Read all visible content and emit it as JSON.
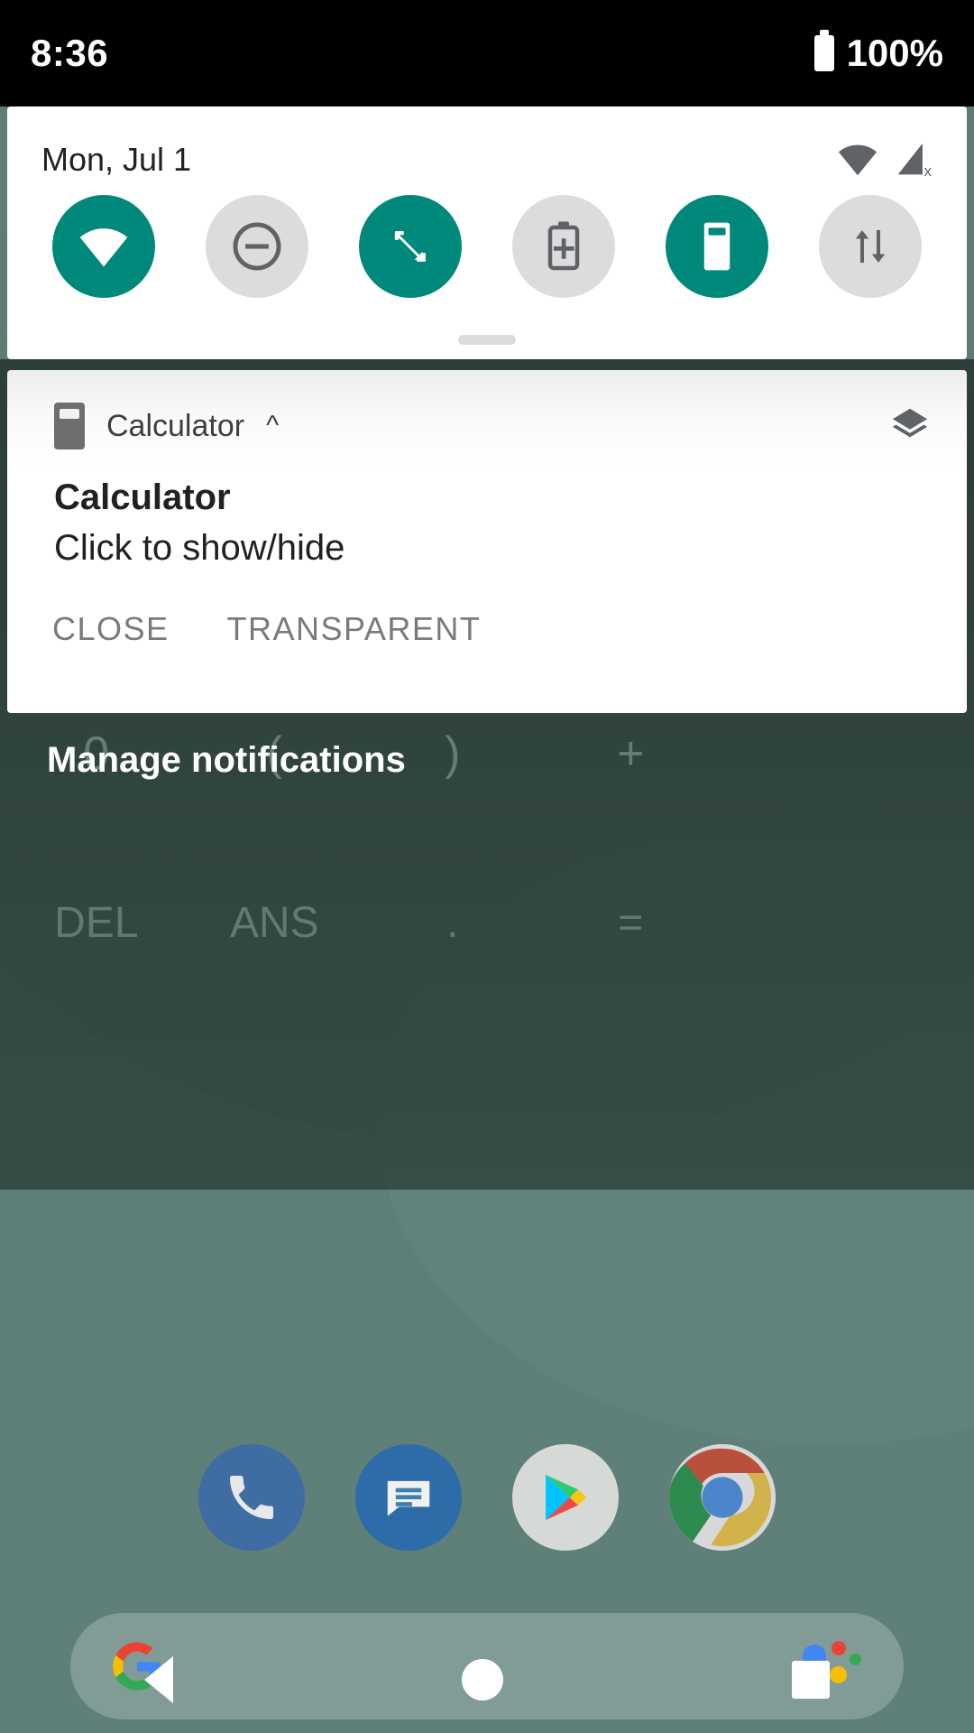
{
  "status_bar": {
    "time": "8:36",
    "battery_percent": "100%",
    "battery_icon": "battery-full-icon"
  },
  "quick_settings": {
    "date": "Mon, Jul 1",
    "status_icons": [
      {
        "name": "wifi-icon"
      },
      {
        "name": "cellular-no-service-icon",
        "badge": "x"
      }
    ],
    "tiles": [
      {
        "name": "wifi-tile",
        "icon": "wifi-icon",
        "state": "on"
      },
      {
        "name": "do-not-disturb-tile",
        "icon": "do-not-disturb-icon",
        "state": "off"
      },
      {
        "name": "auto-rotate-tile",
        "icon": "auto-rotate-icon",
        "state": "on"
      },
      {
        "name": "battery-saver-tile",
        "icon": "battery-plus-icon",
        "state": "off"
      },
      {
        "name": "calculator-tile",
        "icon": "calculator-icon",
        "state": "on"
      },
      {
        "name": "data-saver-tile",
        "icon": "data-transfer-arrows-icon",
        "state": "off"
      }
    ],
    "active_color": "#00897b",
    "inactive_color": "#dcdcdc"
  },
  "notification": {
    "app_name": "Calculator",
    "app_icon": "calculator-app-icon",
    "expand_chevron": "˄",
    "overflow_icon": "layers-icon",
    "title": "Calculator",
    "text": "Click to show/hide",
    "actions": [
      {
        "label": "CLOSE",
        "name": "close-action-button"
      },
      {
        "label": "TRANSPARENT",
        "name": "transparent-action-button"
      }
    ]
  },
  "shade": {
    "manage_label": "Manage notifications"
  },
  "calculator_overlay": {
    "rows": [
      [
        "%",
        "˄",
        "√",
        ""
      ],
      [
        "0",
        "(",
        ")",
        "+"
      ],
      [
        "",
        "",
        "",
        ""
      ],
      [
        "DEL",
        "ANS",
        ".",
        "="
      ]
    ]
  },
  "home": {
    "dock": [
      {
        "name": "phone-icon",
        "label": "Phone"
      },
      {
        "name": "messages-icon",
        "label": "Messages"
      },
      {
        "name": "play-store-icon",
        "label": "Play Store"
      },
      {
        "name": "chrome-icon",
        "label": "Chrome"
      }
    ],
    "search": {
      "logo": "google-g-icon",
      "assistant": "google-assistant-icon",
      "placeholder": ""
    }
  },
  "nav_bar": {
    "back": "back-triangle-icon",
    "home": "home-circle-icon",
    "recents": "recents-square-icon"
  }
}
